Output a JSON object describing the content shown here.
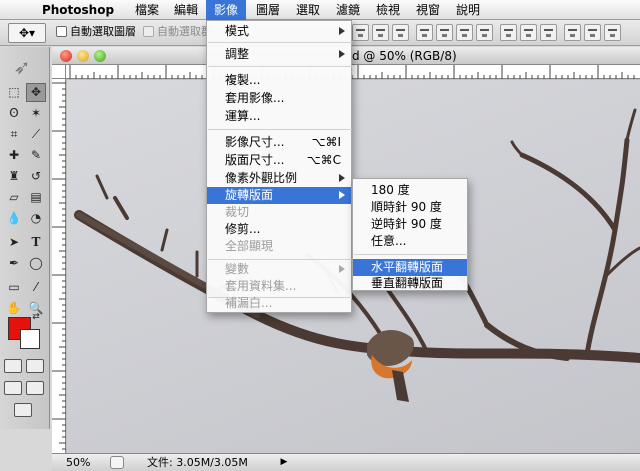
{
  "menubar": {
    "app": "Photoshop",
    "items": [
      "檔案",
      "編輯",
      "影像",
      "圖層",
      "選取",
      "濾鏡",
      "檢視",
      "視窗",
      "說明"
    ]
  },
  "options": {
    "auto_select_layer": "自動選取圖層",
    "auto_select_group": "自動選取群"
  },
  "document": {
    "title": "d @ 50% (RGB/8)",
    "zoom": "50%",
    "size": "文件: 3.05M/3.05M"
  },
  "image_menu": {
    "items": [
      {
        "label": "模式",
        "submenu": true
      },
      {
        "label": "調整",
        "submenu": true
      },
      {
        "label": "複製..."
      },
      {
        "label": "套用影像..."
      },
      {
        "label": "運算..."
      },
      {
        "label": "影像尺寸...",
        "shortcut": "⌥⌘I"
      },
      {
        "label": "版面尺寸...",
        "shortcut": "⌥⌘C"
      },
      {
        "label": "像素外觀比例",
        "submenu": true
      },
      {
        "label": "旋轉版面",
        "submenu": true,
        "highlighted": true
      },
      {
        "label": "裁切",
        "disabled": true
      },
      {
        "label": "修剪..."
      },
      {
        "label": "全部顯現",
        "disabled": true
      },
      {
        "label": "變數",
        "submenu": true,
        "disabled": true
      },
      {
        "label": "套用資料集...",
        "disabled": true
      },
      {
        "label": "補漏白...",
        "disabled": true
      }
    ]
  },
  "rotate_menu": {
    "items": [
      {
        "label": "180 度"
      },
      {
        "label": "順時針 90 度"
      },
      {
        "label": "逆時針 90 度"
      },
      {
        "label": "任意..."
      },
      {
        "label": "水平翻轉版面",
        "highlighted": true
      },
      {
        "label": "垂直翻轉版面"
      }
    ]
  },
  "colors": {
    "accent": "#3875d7",
    "foreground": "#e3120d",
    "background": "#ffffff"
  }
}
